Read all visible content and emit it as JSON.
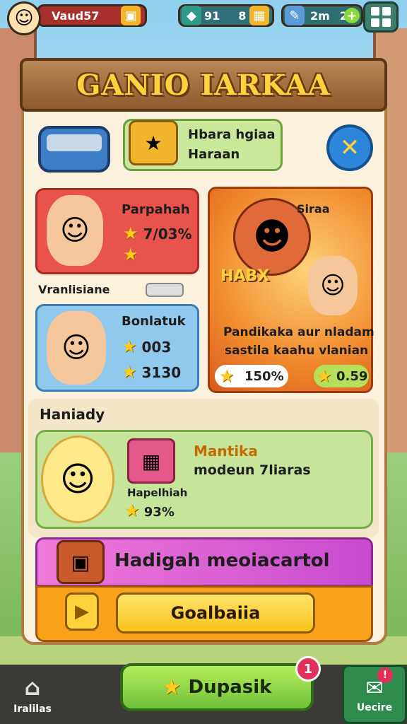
{
  "topbar": {
    "pill1_value": "Vaud57",
    "pill2_value_a": "91",
    "pill2_value_b": "8",
    "pill3_value_a": "2m",
    "pill3_value_b": "2"
  },
  "title": "GANIO IARKAA",
  "offer": {
    "line1": "Hbara hgiaa",
    "line2": "Haraan"
  },
  "card_a": {
    "label": "Parpahah",
    "stat": "7/03%"
  },
  "subhead": "Vranlisiane",
  "card_b": {
    "label": "Bonlatuk",
    "stat1": "003",
    "stat2": "3130"
  },
  "card_c": {
    "label": "Siraa",
    "badge": "HABX",
    "desc_line1": "Pandikaka aur nladam",
    "desc_line2": "sastila kaahu vlanian",
    "stat1": "150%",
    "stat2": "0.59"
  },
  "section": {
    "heading": "Haniady",
    "title": "Mantika",
    "subtitle": "modeun 7liaras",
    "small_label": "Hapelhiah",
    "stat": "93%"
  },
  "promo": {
    "title": "Hadigah meoiacartol",
    "button": "Goalbaiia"
  },
  "bottom_nav": {
    "home_label": "Iralilas",
    "center_label": "Dupasik",
    "badge_count": "1",
    "right_label": "Uecire"
  },
  "colors": {
    "accent_gold": "#ffd23c",
    "panel_cream": "#fbf1dc",
    "close_blue": "#2d86d9",
    "card_red": "#e8544c",
    "card_blue": "#8fc9ee",
    "promo_pink": "#c84bd0",
    "nav_green": "#6fc13a"
  },
  "icons": [
    "avatar-icon",
    "chest-icon",
    "gem-icon",
    "pencil-icon",
    "grid-icon",
    "controller-icon",
    "close-icon",
    "star-icon",
    "play-icon",
    "home-icon",
    "message-icon"
  ]
}
